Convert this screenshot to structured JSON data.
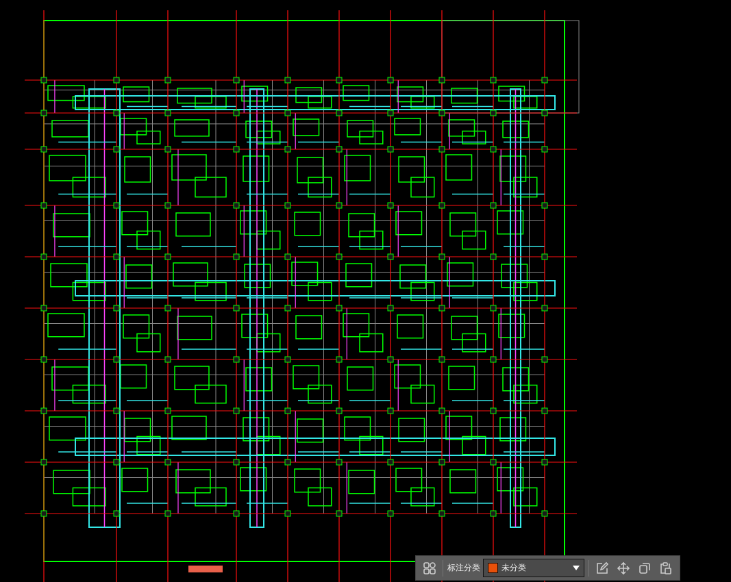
{
  "toolbar": {
    "label": "标注分类",
    "category": {
      "name": "未分类",
      "color": "#e8500a"
    }
  }
}
